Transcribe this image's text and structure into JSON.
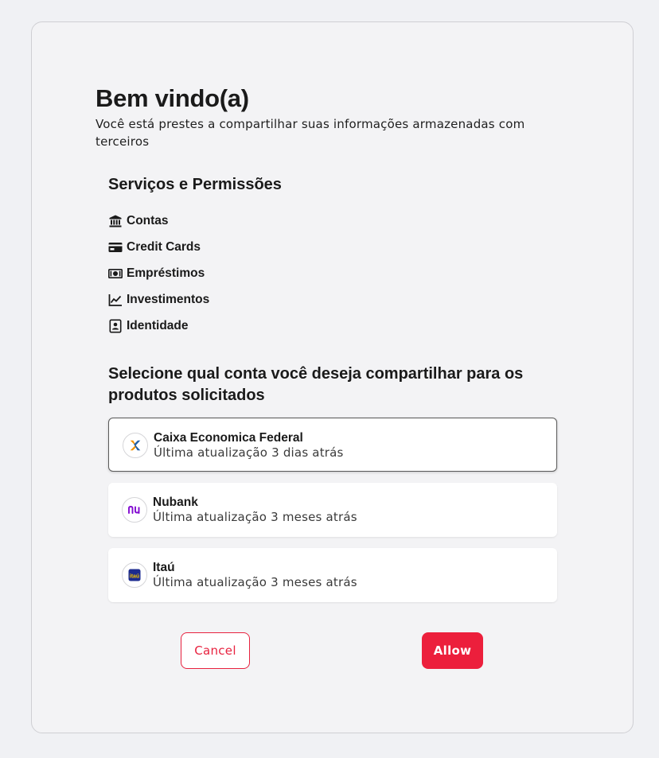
{
  "header": {
    "title": "Bem vindo(a)",
    "subtitle": "Você está prestes a compartilhar suas informações armazenadas com terceiros"
  },
  "permissions": {
    "title": "Serviços e Permissões",
    "items": [
      {
        "label": "Contas",
        "icon": "bank-icon"
      },
      {
        "label": "Credit Cards",
        "icon": "credit-card-icon"
      },
      {
        "label": "Empréstimos",
        "icon": "money-bill-icon"
      },
      {
        "label": "Investimentos",
        "icon": "chart-line-icon"
      },
      {
        "label": "Identidade",
        "icon": "id-card-icon"
      }
    ]
  },
  "accounts": {
    "title": "Selecione qual conta você deseja compartilhar para os produtos solicitados",
    "items": [
      {
        "name": "Caixa Economica Federal",
        "updated": "Última atualização 3 dias atrás",
        "selected": true,
        "logo": "caixa-logo"
      },
      {
        "name": "Nubank",
        "updated": "Última atualização 3 meses atrás",
        "selected": false,
        "logo": "nubank-logo"
      },
      {
        "name": "Itaú",
        "updated": "Última atualização 3 meses atrás",
        "selected": false,
        "logo": "itau-logo",
        "logo_text": "itaú"
      }
    ]
  },
  "actions": {
    "cancel_label": "Cancel",
    "allow_label": "Allow"
  },
  "colors": {
    "accent": "#ec1f3c",
    "background": "#f0f1f4",
    "card": "#f3f3f5",
    "nubank": "#820ad1",
    "itau_bg": "#1c2b8f",
    "itau_text": "#f5c400",
    "caixa_blue": "#1f5fa8",
    "caixa_orange": "#f39200"
  }
}
